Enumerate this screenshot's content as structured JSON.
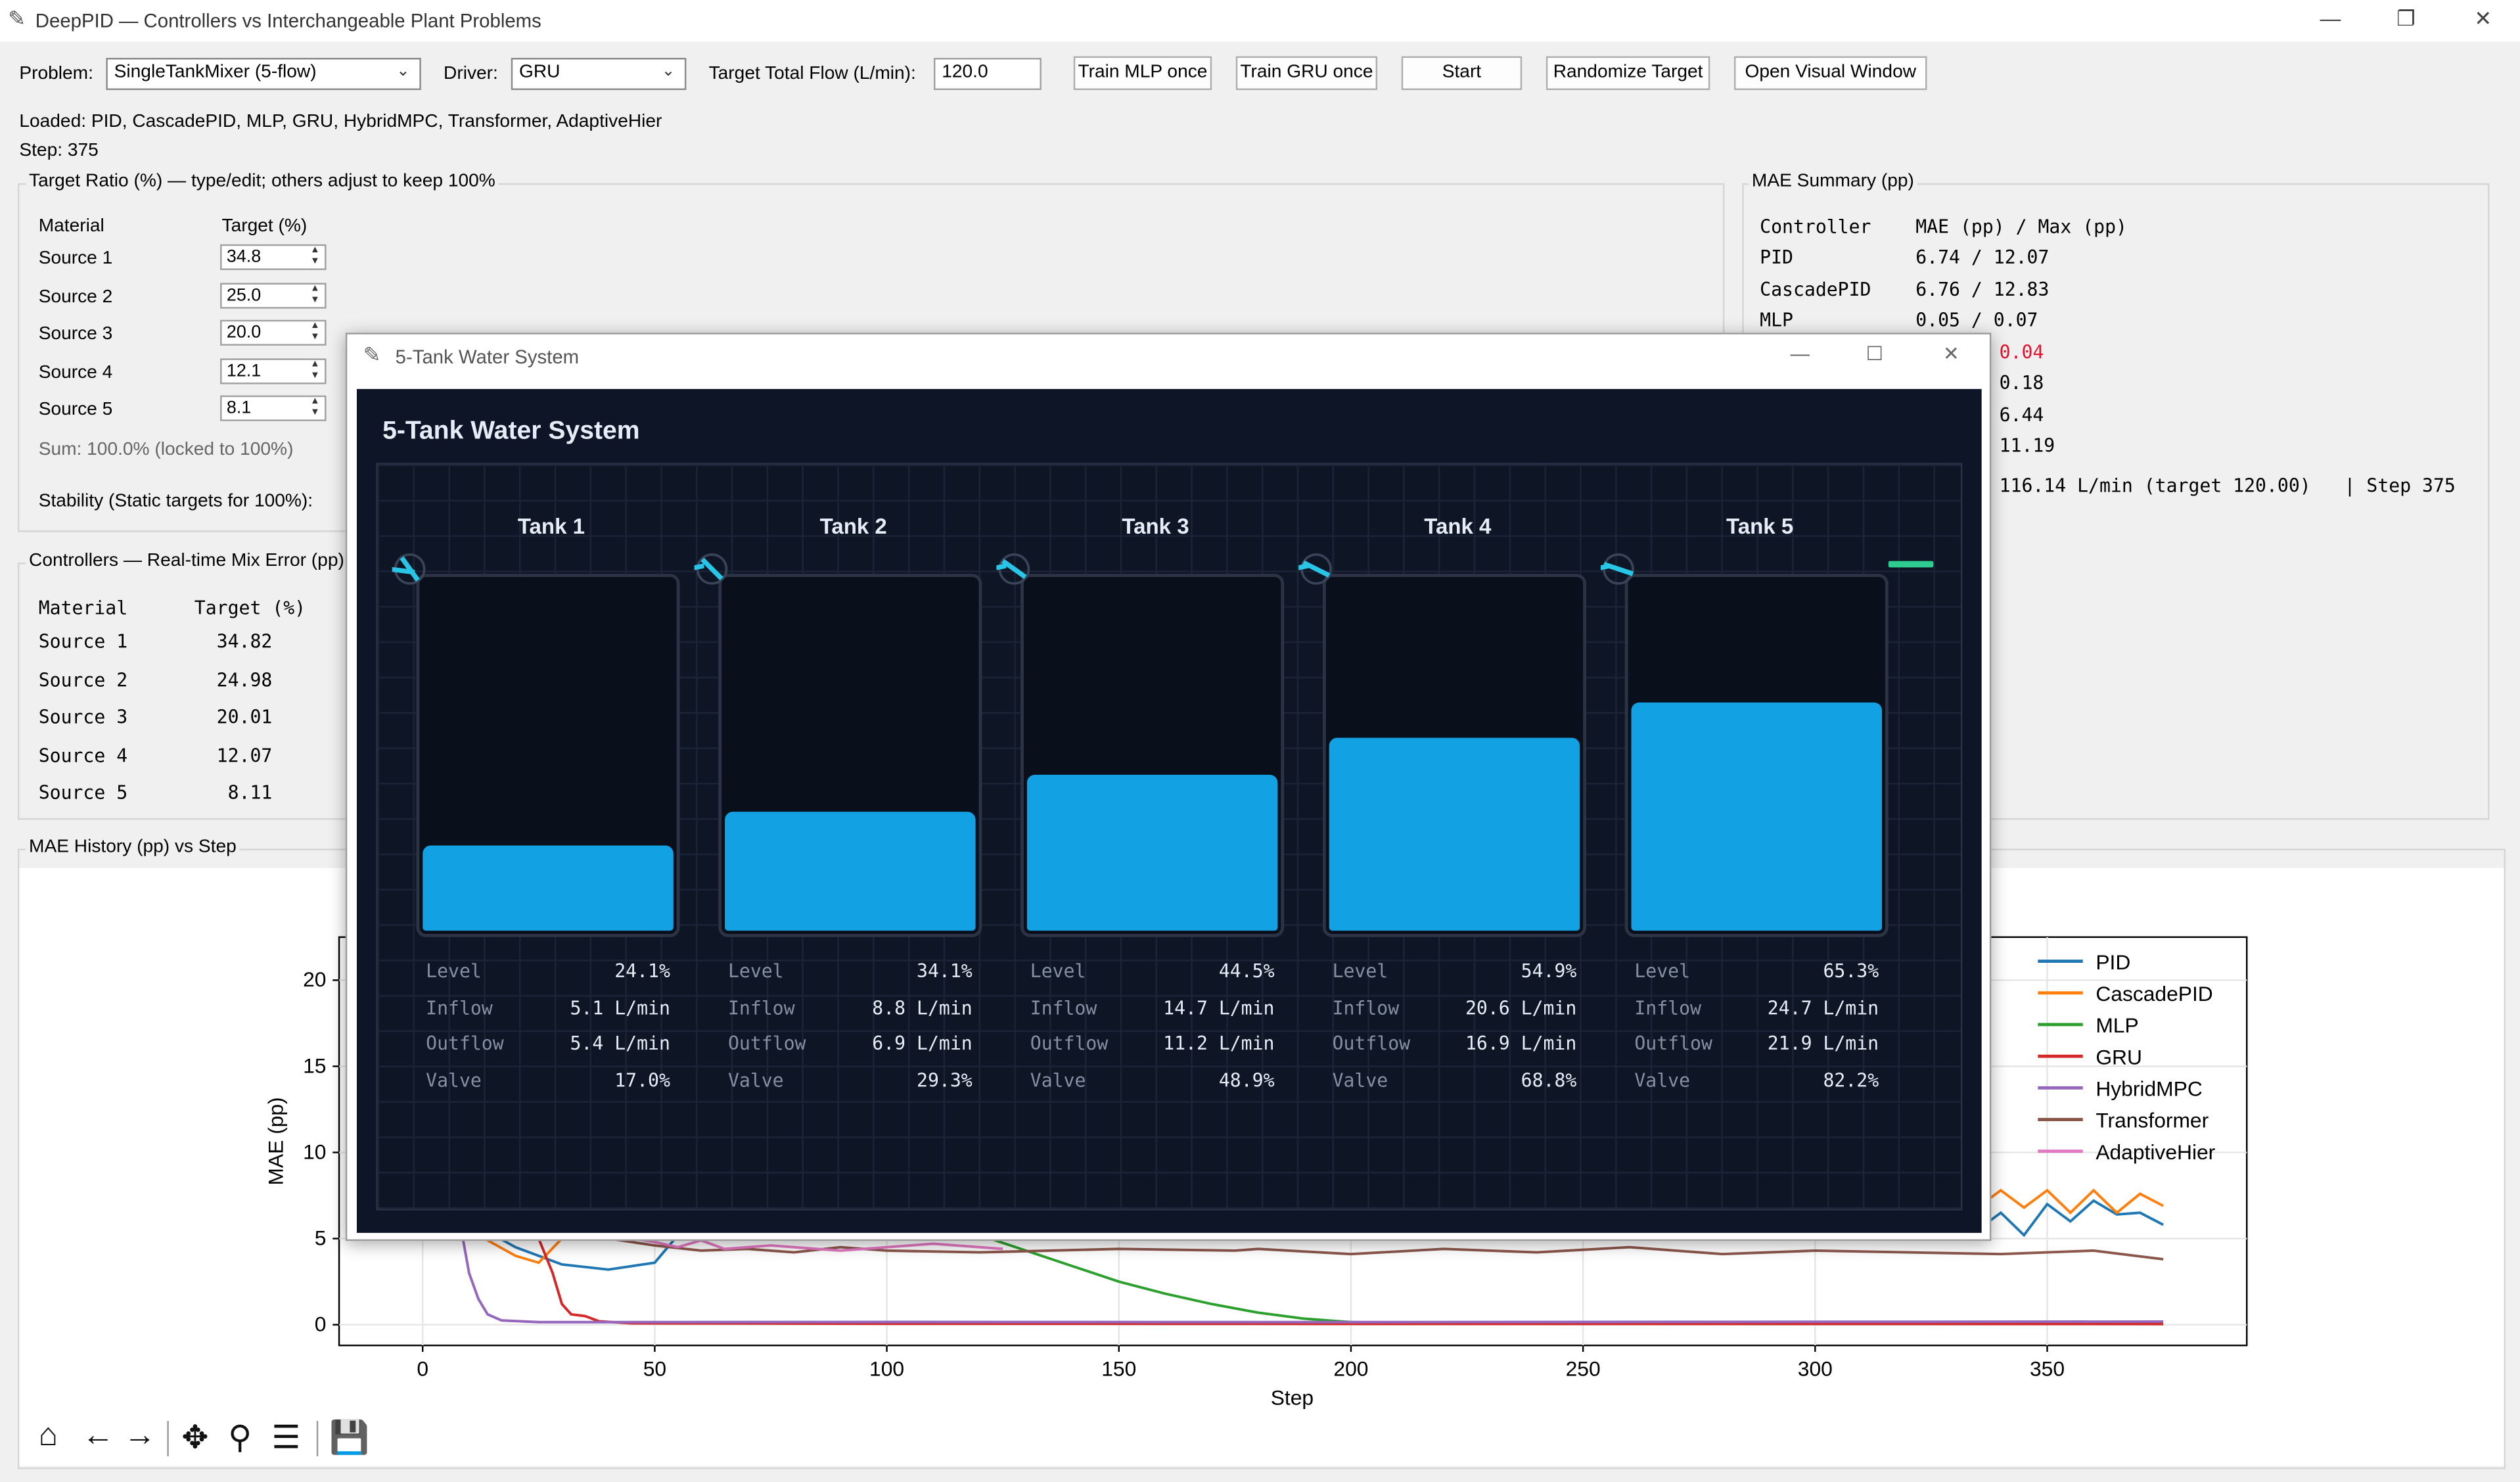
{
  "window": {
    "title": "DeepPID — Controllers vs Interchangeable Plant Problems",
    "minimize": "—",
    "maximize": "❐",
    "close": "✕"
  },
  "toolbar": {
    "problem_label": "Problem:",
    "problem_value": "SingleTankMixer (5-flow)",
    "driver_label": "Driver:",
    "driver_value": "GRU",
    "flow_label": "Target Total Flow (L/min):",
    "flow_value": "120.0",
    "train_mlp": "Train MLP once",
    "train_gru": "Train GRU once",
    "start": "Start",
    "randomize": "Randomize Target",
    "open_visual": "Open Visual Window"
  },
  "status": {
    "loaded": "Loaded: PID, CascadePID, MLP, GRU, HybridMPC, Transformer, AdaptiveHier",
    "step": "Step: 375"
  },
  "target_ratio": {
    "title": "Target Ratio (%) — type/edit; others adjust to keep 100%",
    "col_material": "Material",
    "col_target": "Target (%)",
    "rows": [
      {
        "name": "Source 1",
        "value": "34.8"
      },
      {
        "name": "Source 2",
        "value": "25.0"
      },
      {
        "name": "Source 3",
        "value": "20.0"
      },
      {
        "name": "Source 4",
        "value": "12.1"
      },
      {
        "name": "Source 5",
        "value": "8.1"
      }
    ],
    "sum": "Sum: 100.0% (locked to 100%)",
    "stability": "Stability (Static targets for 100%):"
  },
  "controllers": {
    "title": "Controllers — Real-time Mix Error (pp)",
    "header": "Material      Target (%)",
    "rows": [
      "Source 1        34.82",
      "Source 2        24.98",
      "Source 3        20.01",
      "Source 4        12.07",
      "Source 5         8.11"
    ]
  },
  "mae_summary": {
    "title": "MAE Summary (pp)",
    "header": "Controller    MAE (pp) / Max (pp)",
    "rows": [
      {
        "text": "PID           6.74 / 12.07",
        "highlight": false
      },
      {
        "text": "CascadePID    6.76 / 12.83",
        "highlight": false
      },
      {
        "text": "MLP           0.05 / 0.07",
        "highlight": false
      },
      {
        "text": "0.04",
        "highlight": true
      },
      {
        "text": "0.18",
        "highlight": false
      },
      {
        "text": "6.44",
        "highlight": false
      },
      {
        "text": "11.19",
        "highlight": false
      }
    ],
    "footer": "116.14 L/min (target 120.00)   | Step 375",
    "highlight_color": "#e8102c"
  },
  "mae_history": {
    "title": "MAE History (pp) vs Step"
  },
  "chart_data": {
    "type": "line",
    "xlabel": "Step",
    "ylabel": "MAE (pp)",
    "xlim": [
      -18,
      393
    ],
    "ylim": [
      -1.2,
      22.5
    ],
    "xticks": [
      "0",
      "50",
      "100",
      "150",
      "200",
      "250",
      "300",
      "350"
    ],
    "yticks": [
      "0",
      "5",
      "10",
      "15",
      "20"
    ],
    "legend_position": "top-right",
    "series": [
      {
        "name": "PID",
        "color": "#1f77b4",
        "points": [
          [
            0,
            8
          ],
          [
            10,
            6
          ],
          [
            20,
            4.5
          ],
          [
            30,
            3.5
          ],
          [
            40,
            3.2
          ],
          [
            50,
            3.6
          ],
          [
            55,
            5.2
          ],
          [
            335,
            5.5
          ],
          [
            340,
            6.5
          ],
          [
            345,
            5.2
          ],
          [
            350,
            7
          ],
          [
            355,
            6
          ],
          [
            360,
            7.2
          ],
          [
            365,
            6.4
          ],
          [
            370,
            6.5
          ],
          [
            375,
            5.8
          ]
        ]
      },
      {
        "name": "CascadePID",
        "color": "#ff7f0e",
        "points": [
          [
            0,
            8
          ],
          [
            10,
            5.5
          ],
          [
            20,
            4
          ],
          [
            25,
            3.6
          ],
          [
            30,
            5
          ],
          [
            335,
            6.8
          ],
          [
            340,
            7.8
          ],
          [
            345,
            6.8
          ],
          [
            350,
            7.8
          ],
          [
            355,
            6.5
          ],
          [
            360,
            7.8
          ],
          [
            365,
            6.5
          ],
          [
            370,
            7.6
          ],
          [
            375,
            6.9
          ]
        ]
      },
      {
        "name": "MLP",
        "color": "#2ca02c",
        "points": [
          [
            120,
            5.2
          ],
          [
            130,
            4.3
          ],
          [
            140,
            3.4
          ],
          [
            150,
            2.5
          ],
          [
            160,
            1.8
          ],
          [
            170,
            1.2
          ],
          [
            180,
            0.7
          ],
          [
            190,
            0.35
          ],
          [
            200,
            0.15
          ],
          [
            215,
            0.08
          ],
          [
            250,
            0.06
          ],
          [
            300,
            0.05
          ],
          [
            375,
            0.05
          ]
        ]
      },
      {
        "name": "GRU",
        "color": "#d62728",
        "points": [
          [
            25,
            5
          ],
          [
            28,
            3
          ],
          [
            30,
            1.2
          ],
          [
            32,
            0.6
          ],
          [
            35,
            0.5
          ],
          [
            38,
            0.2
          ],
          [
            45,
            0.08
          ],
          [
            100,
            0.06
          ],
          [
            200,
            0.05
          ],
          [
            300,
            0.05
          ],
          [
            375,
            0.04
          ]
        ]
      },
      {
        "name": "HybridMPC",
        "color": "#9467bd",
        "points": [
          [
            5,
            12
          ],
          [
            8,
            6
          ],
          [
            10,
            3
          ],
          [
            12,
            1.5
          ],
          [
            14,
            0.6
          ],
          [
            17,
            0.25
          ],
          [
            25,
            0.15
          ],
          [
            50,
            0.15
          ],
          [
            100,
            0.16
          ],
          [
            200,
            0.15
          ],
          [
            300,
            0.17
          ],
          [
            375,
            0.18
          ]
        ]
      },
      {
        "name": "Transformer",
        "color": "#8c564b",
        "points": [
          [
            40,
            5
          ],
          [
            50,
            4.6
          ],
          [
            60,
            4.3
          ],
          [
            70,
            4.4
          ],
          [
            80,
            4.2
          ],
          [
            90,
            4.5
          ],
          [
            100,
            4.3
          ],
          [
            120,
            4.2
          ],
          [
            150,
            4.4
          ],
          [
            175,
            4.3
          ],
          [
            180,
            4.4
          ],
          [
            200,
            4.1
          ],
          [
            220,
            4.4
          ],
          [
            240,
            4.2
          ],
          [
            260,
            4.5
          ],
          [
            280,
            4.1
          ],
          [
            300,
            4.3
          ],
          [
            320,
            4.2
          ],
          [
            340,
            4.1
          ],
          [
            360,
            4.3
          ],
          [
            375,
            3.8
          ]
        ]
      },
      {
        "name": "AdaptiveHier",
        "color": "#e377c2",
        "points": [
          [
            45,
            5
          ],
          [
            50,
            4.8
          ],
          [
            55,
            4.5
          ],
          [
            60,
            4.9
          ],
          [
            65,
            4.4
          ],
          [
            75,
            4.6
          ],
          [
            90,
            4.3
          ],
          [
            110,
            4.7
          ],
          [
            125,
            4.4
          ]
        ]
      }
    ]
  },
  "chart_toolbar": [
    {
      "name": "home",
      "glyph": "⌂"
    },
    {
      "name": "back",
      "glyph": "←"
    },
    {
      "name": "forward",
      "glyph": "→"
    },
    {
      "name": "pan",
      "glyph": "✥"
    },
    {
      "name": "zoom",
      "glyph": "⚲"
    },
    {
      "name": "configure",
      "glyph": "☰"
    },
    {
      "name": "save",
      "glyph": "💾"
    }
  ],
  "popup": {
    "title": "5-Tank Water System",
    "minimize": "—",
    "maximize": "☐",
    "close": "✕",
    "heading": "5-Tank Water System",
    "labels": {
      "level": "Level",
      "inflow": "Inflow",
      "outflow": "Outflow",
      "valve": "Valve"
    },
    "tanks": [
      {
        "name": "Tank 1",
        "level": "24.1%",
        "inflow": "5.1 L/min",
        "outflow": "5.4 L/min",
        "valve": "17.0%",
        "fill": 0.241
      },
      {
        "name": "Tank 2",
        "level": "34.1%",
        "inflow": "8.8 L/min",
        "outflow": "6.9 L/min",
        "valve": "29.3%",
        "fill": 0.341
      },
      {
        "name": "Tank 3",
        "level": "44.5%",
        "inflow": "14.7 L/min",
        "outflow": "11.2 L/min",
        "valve": "48.9%",
        "fill": 0.445
      },
      {
        "name": "Tank 4",
        "level": "54.9%",
        "inflow": "20.6 L/min",
        "outflow": "16.9 L/min",
        "valve": "68.8%",
        "fill": 0.549
      },
      {
        "name": "Tank 5",
        "level": "65.3%",
        "inflow": "24.7 L/min",
        "outflow": "21.9 L/min",
        "valve": "82.2%",
        "fill": 0.653
      }
    ],
    "water_color": "#12a1e3",
    "pipe_color": "#29c5e6",
    "outlet_color": "#2ecc8f"
  }
}
